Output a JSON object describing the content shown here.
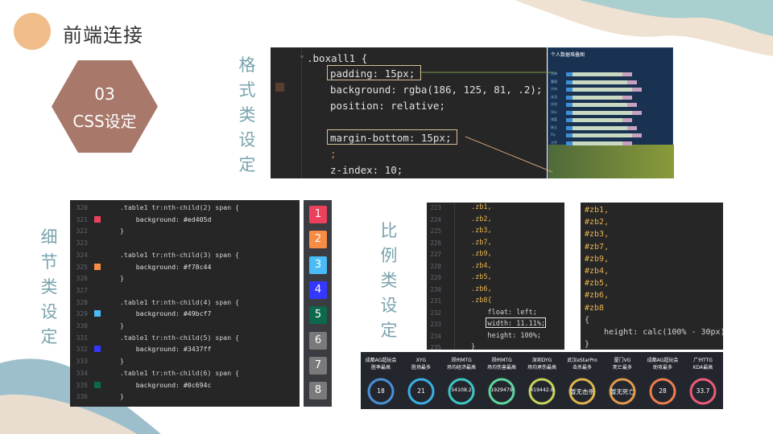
{
  "title": "前端连接",
  "section": {
    "number": "03",
    "name": "CSS设定"
  },
  "labels": {
    "format": [
      "格",
      "式",
      "类",
      "设",
      "定"
    ],
    "detail": [
      "细",
      "节",
      "类",
      "设",
      "定"
    ],
    "ratio": [
      "比",
      "例",
      "类",
      "设",
      "定"
    ]
  },
  "code1": {
    "lines": [
      ".boxall1 {",
      "padding: 15px;",
      "background: rgba(186, 125, 81, .2);",
      "position: relative;",
      "",
      "margin-bottom: 15px;",
      ";",
      "z-index: 10;"
    ]
  },
  "chart_shot": {
    "title": "个人数据堆叠图",
    "rows": [
      "刘禅",
      "曹操",
      "吕布",
      "关羽",
      "孙尚",
      "Obc",
      "诸葛",
      "杨玉",
      "Fly",
      "大乔"
    ]
  },
  "code2": {
    "gutter": [
      "320",
      "321",
      "322",
      "323",
      "324",
      "325",
      "326",
      "327",
      "328",
      "329",
      "330",
      "331",
      "332",
      "333",
      "334",
      "335",
      "336"
    ],
    "lines": [
      ".table1 tr:nth-child(2) span {",
      "    background: #ed405d",
      "}",
      "",
      ".table1 tr:nth-child(3) span {",
      "    background: #f78c44",
      "}",
      "",
      ".table1 tr:nth-child(4) span {",
      "    background: #49bcf7",
      "}",
      ".table1 tr:nth-child(5) span {",
      "    background: #3437ff",
      "}",
      ".table1 tr:nth-child(6) span {",
      "    background: #0c694c",
      "}"
    ],
    "swatches": [
      "#ed405d",
      "#f78c44",
      "#49bcf7",
      "#3437ff",
      "#0c694c"
    ]
  },
  "ranks": {
    "items": [
      "1",
      "2",
      "3",
      "4",
      "5",
      "6",
      "7",
      "8"
    ],
    "colors": [
      "#ed405d",
      "#f78c44",
      "#49bcf7",
      "#3437ff",
      "#0c694c",
      "#7a7a7a",
      "#7a7a7a",
      "#7a7a7a"
    ]
  },
  "code3": {
    "gutter": [
      "223",
      "224",
      "225",
      "226",
      "227",
      "228",
      "229",
      "230",
      "231",
      "232",
      "233",
      "234",
      "235"
    ],
    "lines": [
      ".zb1,",
      ".zb2,",
      ".zb3,",
      ".zb7,",
      ".zb9,",
      ".zb4,",
      ".zb5,",
      ".zb6,",
      ".zb8{",
      "    float: left;",
      "    width: 11.11%;",
      "    height: 100%;",
      "}"
    ]
  },
  "code4": {
    "lines": [
      "#zb1,",
      "#zb2,",
      "#zb3,",
      "#zb7,",
      "#zb9,",
      "#zb4,",
      "#zb5,",
      "#zb6,",
      "#zb8",
      "{",
      "    height: calc(100% - 30px);",
      "}"
    ]
  },
  "stats": [
    {
      "team": "成都AG超玩会",
      "metric": "胜率最高",
      "value": "18",
      "color": "#4a90d9"
    },
    {
      "team": "XYG",
      "metric": "胜场最多",
      "value": "21",
      "color": "#3ab0e6"
    },
    {
      "team": "郑州MTG",
      "metric": "场均经济最高",
      "value": "54108.2",
      "color": "#3ec6c6"
    },
    {
      "team": "郑州MTG",
      "metric": "场均伤害最高",
      "value": "1929479",
      "color": "#5fd6a0"
    },
    {
      "team": "深圳DYG",
      "metric": "场均承伤最高",
      "value": "419442.8",
      "color": "#c8d35a"
    },
    {
      "team": "武汉eStarPro",
      "metric": "击杀最多",
      "value": "暂无击杀",
      "color": "#e0b44a"
    },
    {
      "team": "厦门VG",
      "metric": "死亡最多",
      "value": "暂无死亡",
      "color": "#e39a4a"
    },
    {
      "team": "成都AG超玩会",
      "metric": "助攻最多",
      "value": "28",
      "color": "#ef7d4e"
    },
    {
      "team": "广州TTG",
      "metric": "KDA最高",
      "value": "33.7",
      "color": "#ef5a78"
    }
  ]
}
